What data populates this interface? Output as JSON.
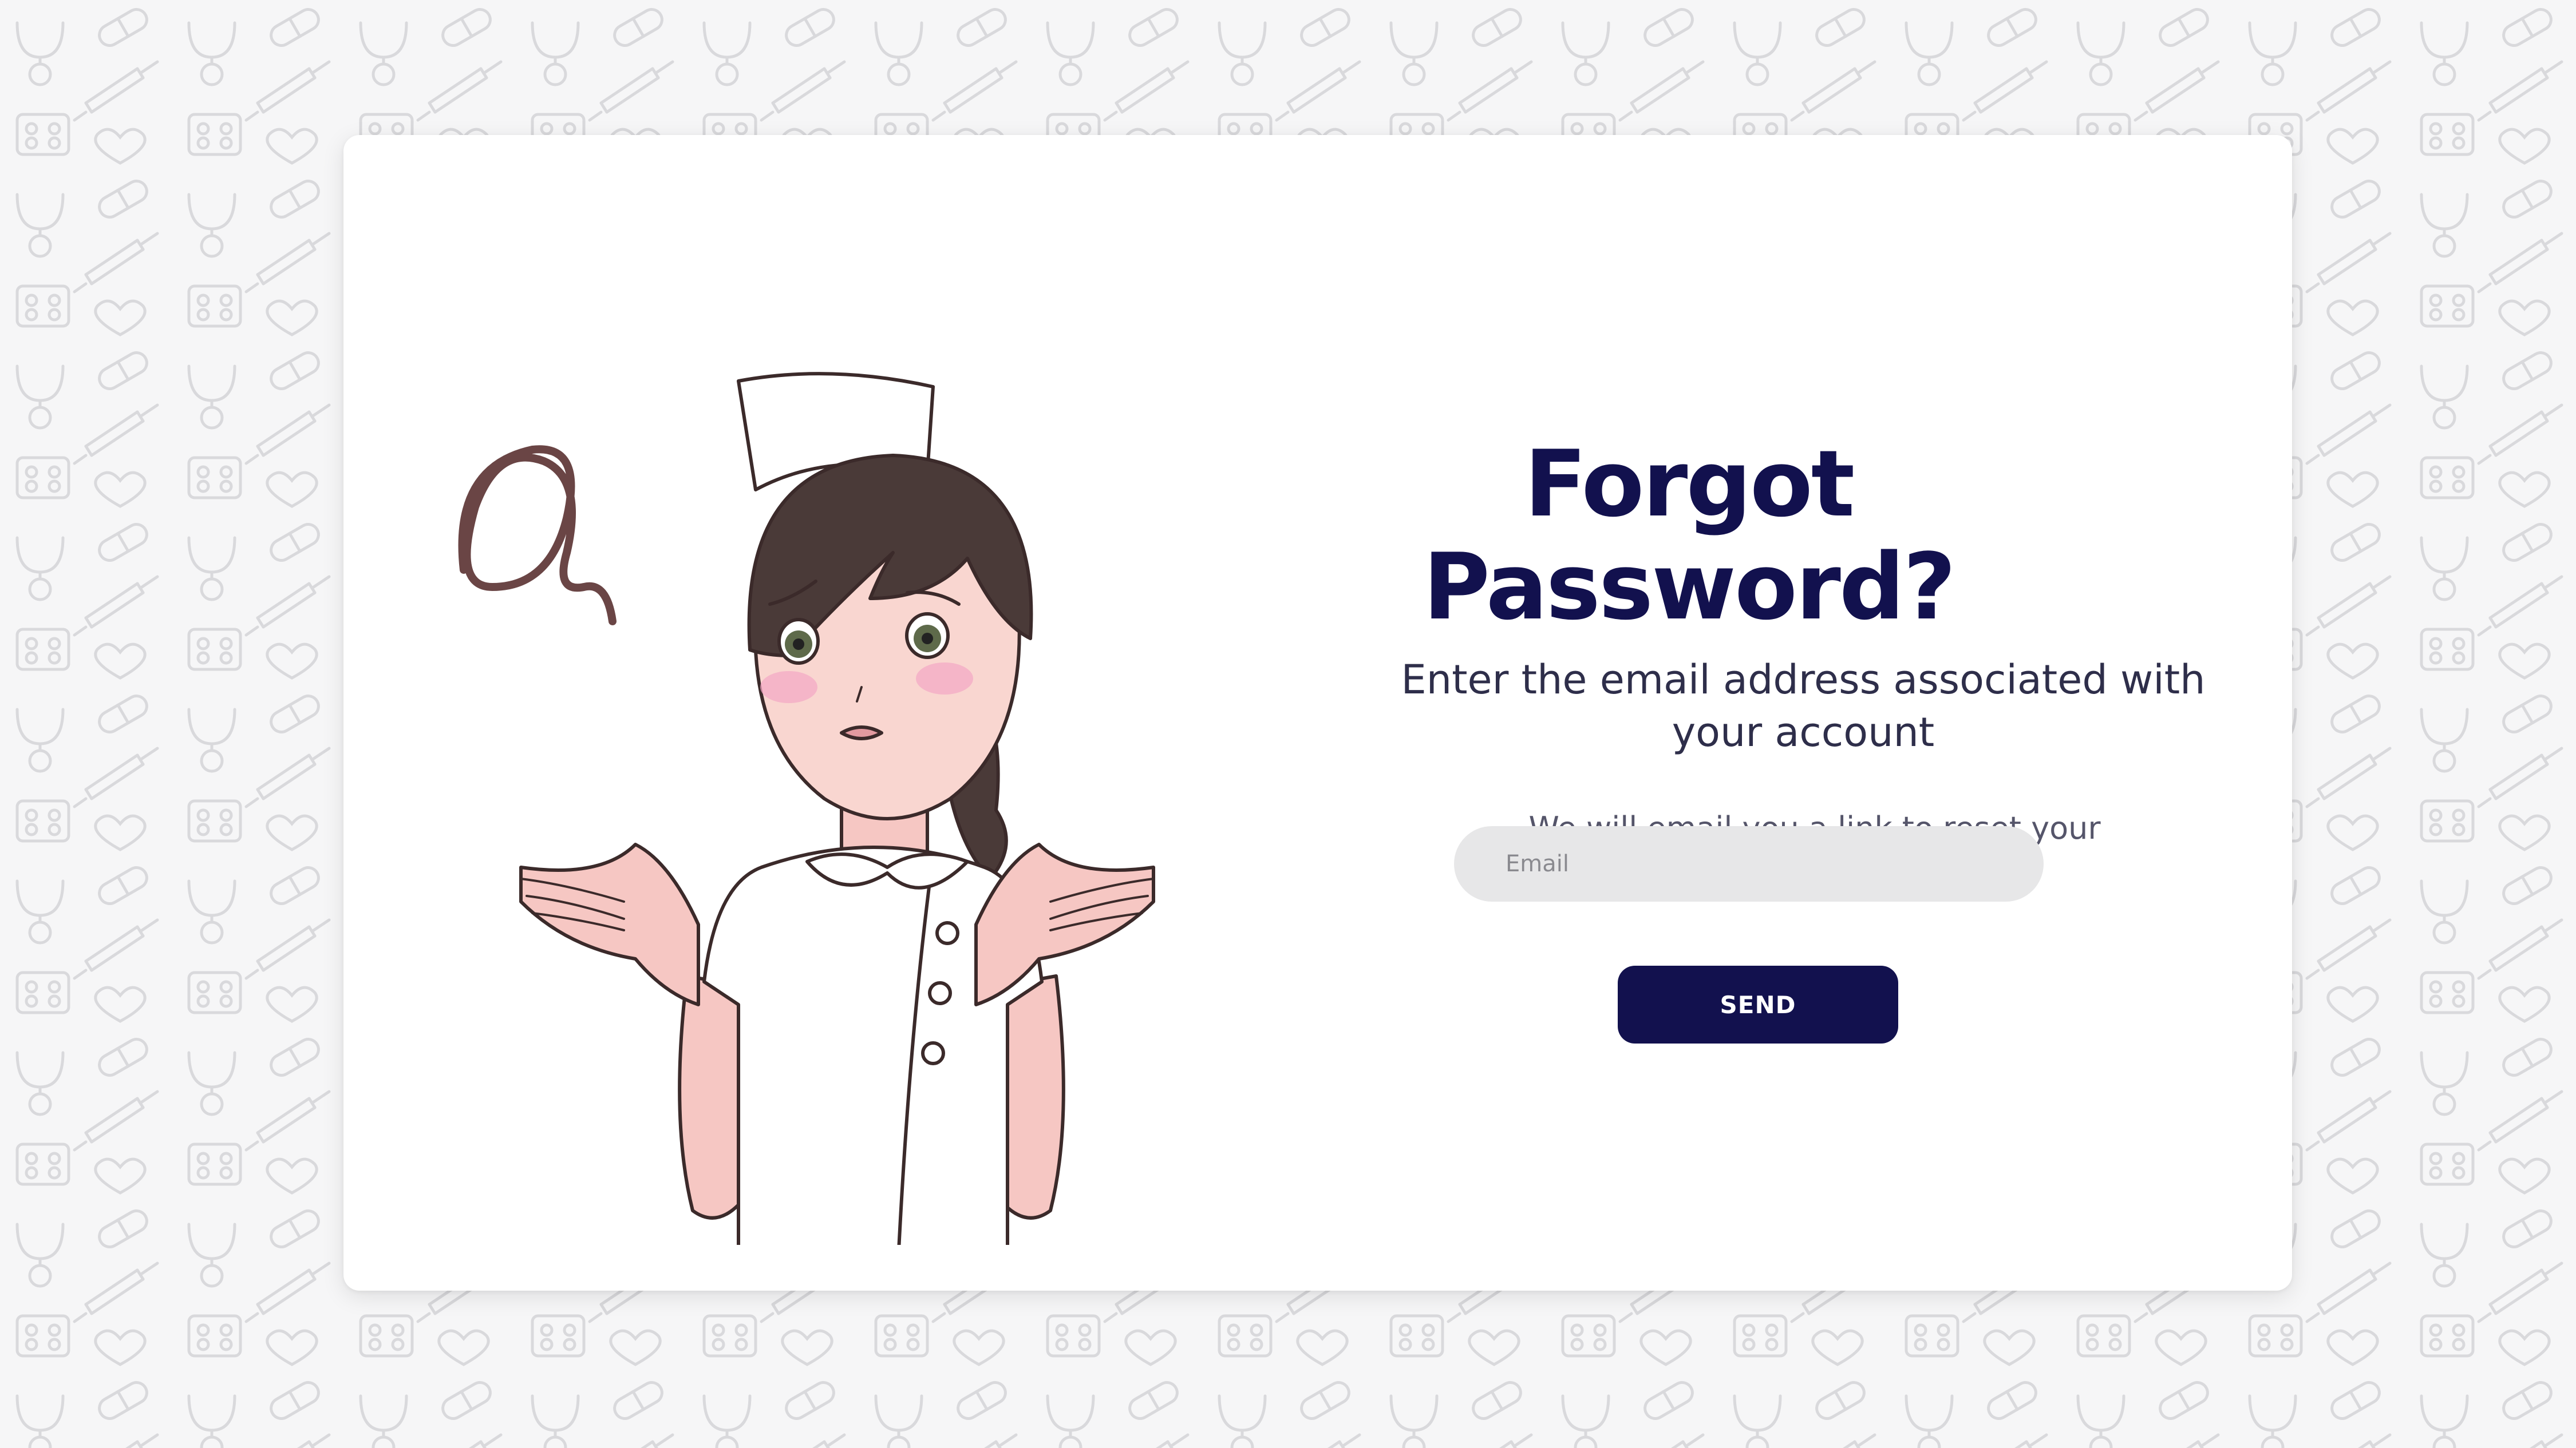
{
  "page": {
    "title": "Forgot Password?",
    "subtitle": "Enter the email address associated with your account",
    "helper": "We will email you a link to reset your password"
  },
  "form": {
    "email_placeholder": "Email",
    "email_value": "",
    "send_label": "SEND"
  },
  "colors": {
    "brand_navy": "#12114e",
    "input_bg": "#e7e7e8",
    "background": "#f6f6f7"
  },
  "illustration": {
    "icon": "confused-nurse-illustration"
  }
}
